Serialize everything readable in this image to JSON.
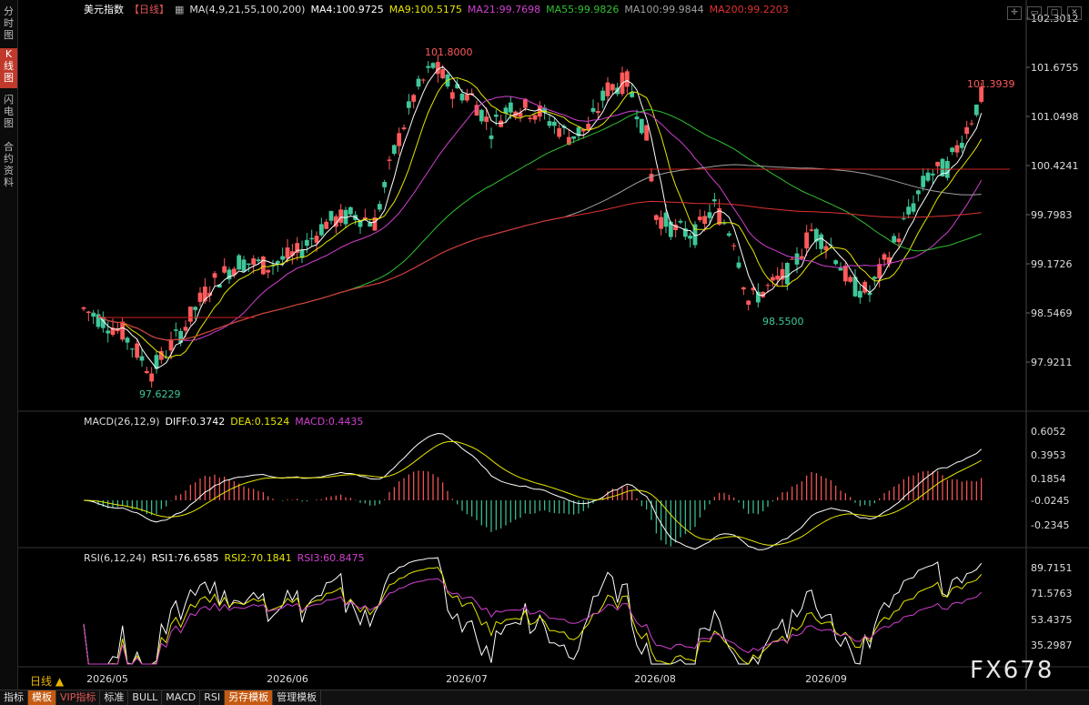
{
  "sidebar": {
    "tabs": [
      {
        "label": "分\n时\n图",
        "active": false
      },
      {
        "label": "K\n线\n图",
        "active": true
      },
      {
        "label": "闪\n电\n图",
        "active": false
      },
      {
        "label": "合\n约\n资\n料",
        "active": false
      }
    ]
  },
  "header": {
    "title": "美元指数",
    "period_tag": "【日线】",
    "ma_params": "MA(4,9,21,55,100,200)",
    "ma_values": [
      {
        "text": "MA4:100.9725",
        "color": "#ffffff"
      },
      {
        "text": "MA9:100.5175",
        "color": "#e6e600"
      },
      {
        "text": "MA21:99.7698",
        "color": "#d040d0"
      },
      {
        "text": "MA55:99.9826",
        "color": "#30c030"
      },
      {
        "text": "MA100:99.9844",
        "color": "#a0a0a0"
      },
      {
        "text": "MA200:99.2203",
        "color": "#e03030"
      }
    ]
  },
  "price_axis": [
    "102.3012",
    "101.6755",
    "101.0498",
    "100.4241",
    "99.7983",
    "99.1726",
    "98.5469",
    "97.9211"
  ],
  "annotations": {
    "high": "101.8000",
    "low1": "97.6229",
    "low2": "98.5500",
    "last": "101.3939"
  },
  "macd": {
    "params": "MACD(26,12,9)",
    "diff": "DIFF:0.3742",
    "dea": "DEA:0.1524",
    "macd": "MACD:0.4435",
    "axis": [
      "0.6052",
      "0.3953",
      "0.1854",
      "-0.0245",
      "-0.2345"
    ]
  },
  "rsi": {
    "params": "RSI(6,12,24)",
    "rsi1": "RSI1:76.6585",
    "rsi2": "RSI2:70.1841",
    "rsi3": "RSI3:60.8475",
    "axis": [
      "89.7151",
      "71.5763",
      "53.4375",
      "35.2987"
    ]
  },
  "x_axis": [
    "2026/05",
    "2026/06",
    "2026/07",
    "2026/08",
    "2026/09"
  ],
  "period_label": "日线 ▲",
  "bottom_tabs": [
    {
      "label": "指标",
      "style": "normal"
    },
    {
      "label": "模板",
      "style": "hl"
    },
    {
      "label": "VIP指标",
      "style": "vip"
    },
    {
      "label": "标准",
      "style": "normal"
    },
    {
      "label": "BULL",
      "style": "normal"
    },
    {
      "label": "MACD",
      "style": "normal"
    },
    {
      "label": "RSI",
      "style": "normal"
    },
    {
      "label": "另存模板",
      "style": "hl"
    },
    {
      "label": "管理模板",
      "style": "normal"
    }
  ],
  "logo_text": "FX678",
  "colors": {
    "up": "#ff5a5a",
    "down": "#3fc79a",
    "ma4": "#ffffff",
    "ma9": "#e6e600",
    "ma21": "#d040d0",
    "ma55": "#30c030",
    "ma100": "#a0a0a0",
    "ma200": "#e03030"
  }
}
